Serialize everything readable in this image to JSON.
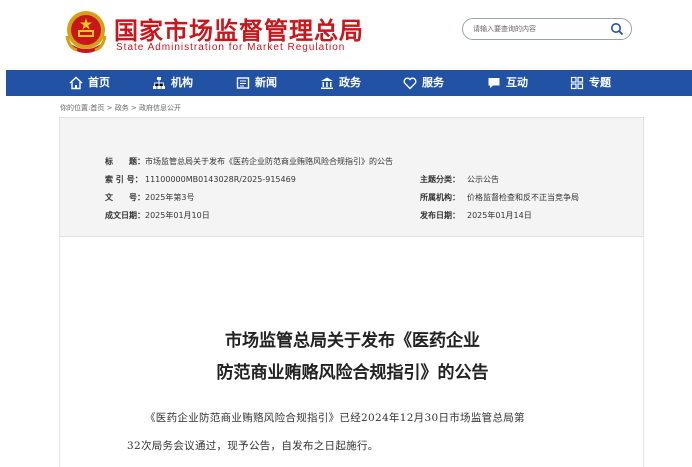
{
  "header": {
    "title_cn": "国家市场监督管理总局",
    "title_en": "State Administration for Market Regulation",
    "search_placeholder": "请输入要查询的内容"
  },
  "nav": {
    "items": [
      {
        "label": "首页",
        "icon": "home-icon"
      },
      {
        "label": "机构",
        "icon": "org-icon"
      },
      {
        "label": "新闻",
        "icon": "news-icon"
      },
      {
        "label": "政务",
        "icon": "government-icon"
      },
      {
        "label": "服务",
        "icon": "heart-icon"
      },
      {
        "label": "互动",
        "icon": "chat-icon"
      },
      {
        "label": "专题",
        "icon": "grid-icon"
      }
    ]
  },
  "breadcrumb": {
    "prefix": "你的位置:",
    "items": [
      "首页",
      "政务",
      "政府信息公开"
    ],
    "separator": " > "
  },
  "meta": {
    "title_label": "标　　题：",
    "title_value": "市场监管总局关于发布《医药企业防范商业贿赂风险合规指引》的公告",
    "index_label": "索 引 号：",
    "index_value": "11100000MB0143028R/2025-915469",
    "doc_label": "文　　号：",
    "doc_value": "2025年第3号",
    "date_label": "成文日期：",
    "date_value": "2025年01月10日",
    "category_label": "主题分类：",
    "category_value": "公示公告",
    "org_label": "所属机构：",
    "org_value": "价格监督检查和反不正当竞争局",
    "publish_label": "发布日期：",
    "publish_value": "2025年01月14日"
  },
  "article": {
    "title_line1": "市场监管总局关于发布《医药企业",
    "title_line2": "防范商业贿赂风险合规指引》的公告",
    "para_line1": "《医药企业防范商业贿赂风险合规指引》已经2024年12月30日市场监管总局第",
    "para_line2": "32次局务会议通过，现予公告，自发布之日起施行。"
  },
  "colors": {
    "brand_red": "#c8161d",
    "nav_blue": "#2152a3",
    "meta_bg": "#f4f4f4"
  }
}
